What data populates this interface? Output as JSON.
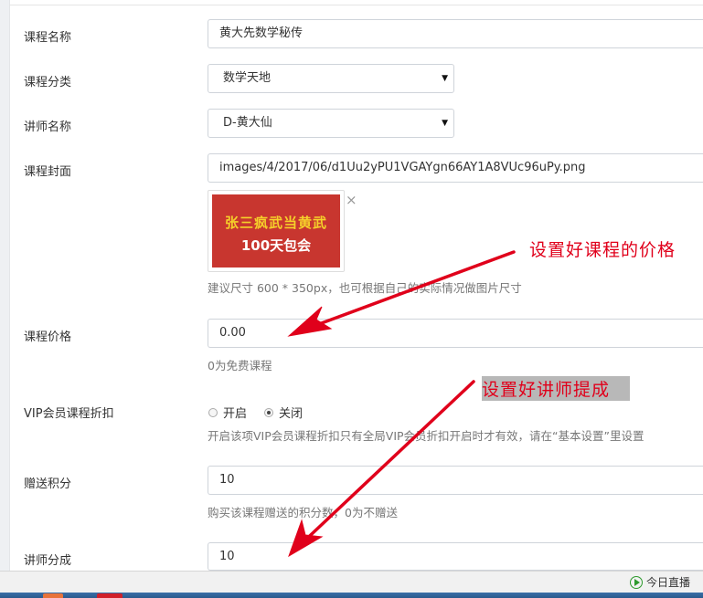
{
  "form": {
    "course_name": {
      "label": "课程名称",
      "value": "黄大先数学秘传"
    },
    "course_category": {
      "label": "课程分类",
      "value": "数学天地"
    },
    "teacher_name": {
      "label": "讲师名称",
      "value": "D-黄大仙"
    },
    "course_cover": {
      "label": "课程封面",
      "value": "images/4/2017/06/d1Uu2yPU1VGAYgn66AY1A8VUc96uPy.png",
      "thumb_line1": "张三疯武当黄武",
      "thumb_line2": "100天包会",
      "close_symbol": "×",
      "help": "建议尺寸 600 * 350px，也可根据自己的实际情况做图片尺寸"
    },
    "course_price": {
      "label": "课程价格",
      "value": "0.00",
      "help": "0为免费课程"
    },
    "vip_discount": {
      "label": "VIP会员课程折扣",
      "option_on": "开启",
      "option_off": "关闭",
      "selected": "关闭",
      "help": "开启该项VIP会员课程折扣只有全局VIP会员折扣开启时才有效，请在“基本设置”里设置"
    },
    "bonus_points": {
      "label": "赠送积分",
      "value": "10",
      "help": "购买该课程赠送的积分数，0为不赠送"
    },
    "teacher_share": {
      "label": "讲师分成",
      "value": "10"
    }
  },
  "annotations": {
    "price_note": "设置好课程的价格",
    "commission_note": "设置好讲师提成"
  },
  "statusbar": {
    "today_live": "今日直播"
  },
  "colors": {
    "annotation_red": "#e0001b",
    "thumb_bg": "#c8362f",
    "status_green": "#2c9a2c"
  }
}
